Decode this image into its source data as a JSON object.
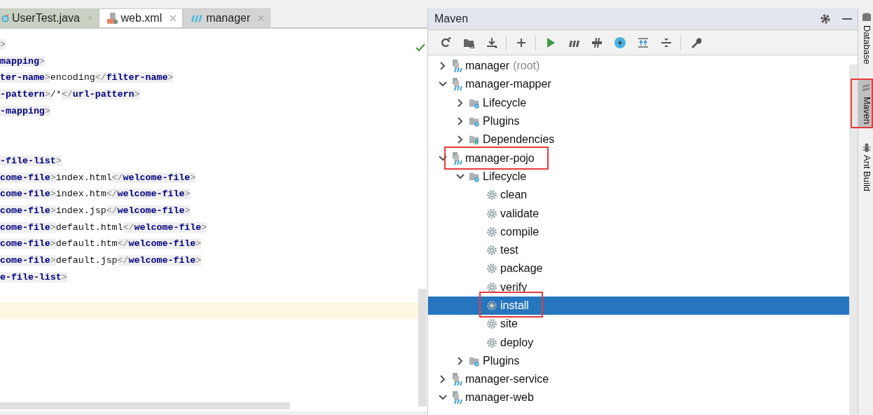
{
  "editor": {
    "tabs": [
      {
        "label": "UserTest.java",
        "kind": "java",
        "selected": false
      },
      {
        "label": "web.xml",
        "kind": "xml",
        "selected": true
      },
      {
        "label": "manager",
        "kind": "maven",
        "selected": false
      }
    ],
    "lines": [
      {
        "kind": "code",
        "segments": [
          {
            "kind": "punct",
            "text": ">"
          }
        ]
      },
      {
        "kind": "code",
        "segments": [
          {
            "kind": "name",
            "text": "mapping"
          },
          {
            "kind": "punct",
            "text": ">"
          }
        ]
      },
      {
        "kind": "code",
        "segments": [
          {
            "kind": "name",
            "text": "ter-name"
          },
          {
            "kind": "punct",
            "text": ">"
          },
          {
            "kind": "text",
            "text": "encoding"
          },
          {
            "kind": "punct",
            "text": "</"
          },
          {
            "kind": "name",
            "text": "filter-name"
          },
          {
            "kind": "punct",
            "text": ">"
          }
        ]
      },
      {
        "kind": "code",
        "segments": [
          {
            "kind": "name",
            "text": "-pattern"
          },
          {
            "kind": "punct",
            "text": ">"
          },
          {
            "kind": "text",
            "text": "/*"
          },
          {
            "kind": "punct",
            "text": "</"
          },
          {
            "kind": "name",
            "text": "url-pattern"
          },
          {
            "kind": "punct",
            "text": ">"
          }
        ]
      },
      {
        "kind": "code",
        "segments": [
          {
            "kind": "name",
            "text": "-mapping"
          },
          {
            "kind": "punct",
            "text": ">"
          }
        ]
      },
      {
        "kind": "blank"
      },
      {
        "kind": "blank"
      },
      {
        "kind": "code",
        "segments": [
          {
            "kind": "name",
            "text": "-file-list"
          },
          {
            "kind": "punct",
            "text": ">"
          }
        ]
      },
      {
        "kind": "code",
        "segments": [
          {
            "kind": "name",
            "text": "come-file"
          },
          {
            "kind": "punct",
            "text": ">"
          },
          {
            "kind": "text",
            "text": "index.html"
          },
          {
            "kind": "punct",
            "text": "</"
          },
          {
            "kind": "name",
            "text": "welcome-file"
          },
          {
            "kind": "punct",
            "text": ">"
          }
        ]
      },
      {
        "kind": "code",
        "segments": [
          {
            "kind": "name",
            "text": "come-file"
          },
          {
            "kind": "punct",
            "text": ">"
          },
          {
            "kind": "text",
            "text": "index.htm"
          },
          {
            "kind": "punct",
            "text": "</"
          },
          {
            "kind": "name",
            "text": "welcome-file"
          },
          {
            "kind": "punct",
            "text": ">"
          }
        ]
      },
      {
        "kind": "code",
        "segments": [
          {
            "kind": "name",
            "text": "come-file"
          },
          {
            "kind": "punct",
            "text": ">"
          },
          {
            "kind": "text",
            "text": "index.jsp"
          },
          {
            "kind": "punct",
            "text": "</"
          },
          {
            "kind": "name",
            "text": "welcome-file"
          },
          {
            "kind": "punct",
            "text": ">"
          }
        ]
      },
      {
        "kind": "code",
        "segments": [
          {
            "kind": "name",
            "text": "come-file"
          },
          {
            "kind": "punct",
            "text": ">"
          },
          {
            "kind": "text",
            "text": "default.html"
          },
          {
            "kind": "punct",
            "text": "</"
          },
          {
            "kind": "name",
            "text": "welcome-file"
          },
          {
            "kind": "punct",
            "text": ">"
          }
        ]
      },
      {
        "kind": "code",
        "segments": [
          {
            "kind": "name",
            "text": "come-file"
          },
          {
            "kind": "punct",
            "text": ">"
          },
          {
            "kind": "text",
            "text": "default.htm"
          },
          {
            "kind": "punct",
            "text": "</"
          },
          {
            "kind": "name",
            "text": "welcome-file"
          },
          {
            "kind": "punct",
            "text": ">"
          }
        ]
      },
      {
        "kind": "code",
        "segments": [
          {
            "kind": "name",
            "text": "come-file"
          },
          {
            "kind": "punct",
            "text": ">"
          },
          {
            "kind": "text",
            "text": "default.jsp"
          },
          {
            "kind": "punct",
            "text": "</"
          },
          {
            "kind": "name",
            "text": "welcome-file"
          },
          {
            "kind": "punct",
            "text": ">"
          }
        ]
      },
      {
        "kind": "code",
        "segments": [
          {
            "kind": "name",
            "text": "e-file-list"
          },
          {
            "kind": "punct",
            "text": ">"
          }
        ]
      },
      {
        "kind": "blank"
      },
      {
        "kind": "caret"
      }
    ]
  },
  "maven": {
    "title": "Maven",
    "tree": [
      {
        "label": "manager",
        "note": "(root)",
        "kind": "module",
        "expanded": false,
        "selected": false,
        "marked": false
      },
      {
        "label": "manager-mapper",
        "kind": "module",
        "expanded": true,
        "selected": false,
        "marked": false,
        "children": [
          {
            "label": "Lifecycle",
            "kind": "lifecycle",
            "expanded": false,
            "selected": false,
            "marked": false
          },
          {
            "label": "Plugins",
            "kind": "plugins",
            "expanded": false,
            "selected": false,
            "marked": false
          },
          {
            "label": "Dependencies",
            "kind": "dependencies",
            "expanded": false,
            "selected": false,
            "marked": false
          }
        ]
      },
      {
        "label": "manager-pojo",
        "kind": "module",
        "expanded": true,
        "selected": false,
        "marked": true,
        "children": [
          {
            "label": "Lifecycle",
            "kind": "lifecycle",
            "expanded": true,
            "selected": false,
            "marked": false,
            "children": [
              {
                "label": "clean",
                "kind": "goal",
                "selected": false,
                "marked": false
              },
              {
                "label": "validate",
                "kind": "goal",
                "selected": false,
                "marked": false
              },
              {
                "label": "compile",
                "kind": "goal",
                "selected": false,
                "marked": false
              },
              {
                "label": "test",
                "kind": "goal",
                "selected": false,
                "marked": false
              },
              {
                "label": "package",
                "kind": "goal",
                "selected": false,
                "marked": false
              },
              {
                "label": "verify",
                "kind": "goal",
                "selected": false,
                "marked": false
              },
              {
                "label": "install",
                "kind": "goal",
                "selected": true,
                "marked": true
              },
              {
                "label": "site",
                "kind": "goal",
                "selected": false,
                "marked": false
              },
              {
                "label": "deploy",
                "kind": "goal",
                "selected": false,
                "marked": false
              }
            ]
          },
          {
            "label": "Plugins",
            "kind": "plugins",
            "expanded": false,
            "selected": false,
            "marked": false
          }
        ]
      },
      {
        "label": "manager-service",
        "kind": "module",
        "expanded": false,
        "selected": false,
        "marked": false
      },
      {
        "label": "manager-web",
        "kind": "module",
        "expanded": true,
        "selected": false,
        "marked": false
      }
    ]
  },
  "side_tabs": [
    {
      "label": "Database",
      "kind": "database",
      "selected": false,
      "marked": false
    },
    {
      "label": "Maven",
      "kind": "maven",
      "selected": true,
      "marked": true
    },
    {
      "label": "Ant Build",
      "kind": "ant",
      "selected": false,
      "marked": false
    }
  ]
}
